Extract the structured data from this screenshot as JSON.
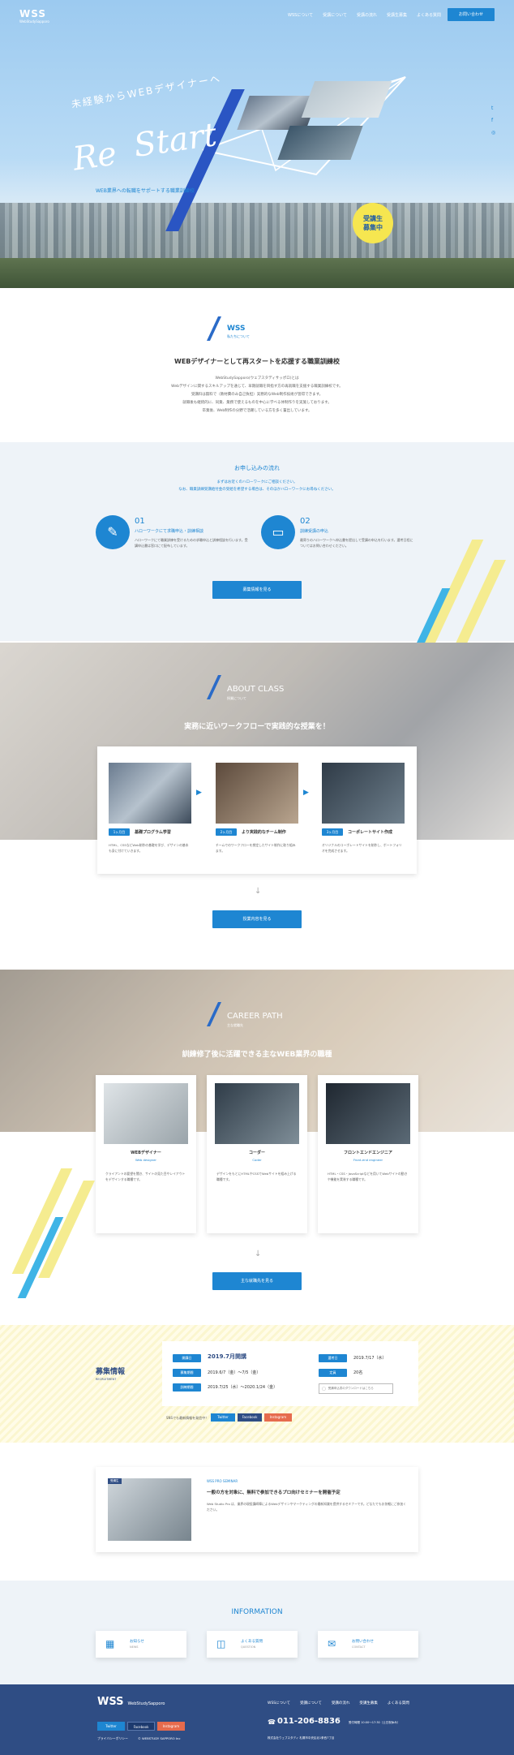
{
  "header": {
    "logo": "WSS",
    "logo_sub": "WebStudySapporo",
    "nav": [
      "WSSについて",
      "受講について",
      "受講の流れ",
      "受講生募集",
      "よくある質問"
    ],
    "cta": "お問い合わせ"
  },
  "hero": {
    "catch": "未経験からWEBデザイナーへ",
    "title_re": "Re",
    "title_start": "Start",
    "sub": "WEB業界への転職をサポートする職業訓練校",
    "badge": "受講生\n募集中",
    "social": [
      "twitter-icon",
      "facebook-icon",
      "instagram-icon"
    ]
  },
  "about": {
    "name": "WSS",
    "kana": "私たちについて",
    "heading": "WEBデザイナーとして再スタートを応援する職業訓練校",
    "body": [
      "WebStudySapporo(ウェブスタディサッポロ)とは",
      "Webデザインに関するスキルアップを通じて、早期就職を目指す方の再就職を支援する職業訓練校です。",
      "受講料は無料で（教材費のみ自己負担）実務的なWeb制作技術が習得できます。",
      "就職後も継続的に、同業、業務で使えるものを中心に学べる体制作りを実施しております。",
      "卒業後、Web制作の分野で活躍している方を多く輩出しています。"
    ]
  },
  "flow": {
    "title": "お申し込みの流れ",
    "desc": [
      "まずはお近くのハローワークにご相談ください。",
      "なお、職業訓練受講給付金の受給を希望する場合は、そのほかハローワークにお尋ねください。"
    ],
    "steps": [
      {
        "num": "01",
        "title": "ハローワークにて求職申込・訓練相談",
        "text": "ハローワークにて職業訓練を受けるための求職申込と訓練相談を行います。受講申込書は窓口にて配布しています。"
      },
      {
        "num": "02",
        "title": "訓練受講の申込",
        "text": "最寄りのハローワークへ申込書を提出して受講の申込を行います。選考日程についてはお問い合わせください。"
      }
    ],
    "button": "募集情報を見る"
  },
  "about_class": {
    "title": "ABOUT CLASS",
    "kana": "授業について",
    "heading": "実務に近いワークフローで実践的な授業を！",
    "steps": [
      {
        "tag": "1ヶ月目",
        "title": "基礎プログラム学習",
        "text": "HTML、CSSなどWeb制作の基礎を学び、デザインの基本も身に付けていきます。"
      },
      {
        "tag": "2ヶ月目",
        "title": "より実践的なチーム制作",
        "text": "チームでのワークフローを想定したサイト制作に取り組みます。"
      },
      {
        "tag": "3ヶ月目",
        "title": "コーポレートサイト作成",
        "text": "オリジナルのコーポレートサイトを制作し、ポートフォリオを完成させます。"
      }
    ],
    "button": "授業内容を見る"
  },
  "career": {
    "title": "CAREER PATH",
    "kana": "主な就職先",
    "heading": "訓練修了後に活躍できる主なWEB業界の職種",
    "jobs": [
      {
        "title": "WEBデザイナー",
        "en": "Web designer",
        "text": "クライアントの要望を聞き、サイトの見た目やレイアウトをデザインする職種です。"
      },
      {
        "title": "コーダー",
        "en": "Coder",
        "text": "デザインをもとにHTMLやCSSでWebサイトを組み上げる職種です。"
      },
      {
        "title": "フロントエンドエンジニア",
        "en": "Front-end engineer",
        "text": "HTML・CSS・JavaScriptなどを用いてWebサイトの動きや機能を実装する職種です。"
      }
    ],
    "button": "主な就職先を見る"
  },
  "recruit": {
    "title": "募集情報",
    "en": "RECRUITMENT",
    "rows": [
      {
        "label": "開講日",
        "value": "2019.7月開講"
      },
      {
        "label": "募集期間",
        "value": "2019.6/7（金）〜7/5（金）"
      },
      {
        "label": "訓練期間",
        "value": "2019.7/25（水）〜2020.1/24（金）"
      }
    ],
    "right": [
      {
        "label": "選考日",
        "value": "2019.7/17（水）"
      },
      {
        "label": "定員",
        "value": "20名"
      }
    ],
    "pdf": "受講申込書のダウンロードはこちら",
    "share": "SNSでも最新情報を発信中！",
    "sns": [
      "Twitter",
      "Facebook",
      "Instagram"
    ]
  },
  "seminar": {
    "tag": "WSS PRO SEMINAR",
    "img_label": "受講生",
    "title": "一般の方を対象に、無料で参加できるプロ向けセミナーを開催予定",
    "text": "Web Studio Pro は、業界の現役講師陣によるWebデザインやマーケティングの最新知識を提供するセミナーです。どなたでもお気軽にご参加ください。"
  },
  "info": {
    "title": "INFORMATION",
    "items": [
      {
        "title": "お知らせ",
        "en": "NEWS"
      },
      {
        "title": "よくある質問",
        "en": "QUESTION"
      },
      {
        "title": "お問い合わせ",
        "en": "CONTACT"
      }
    ]
  },
  "footer": {
    "logo": "WSS",
    "logo_sub": "WebStudySapporo",
    "nav": [
      "WSSについて",
      "受講について",
      "受講の流れ",
      "受講生募集",
      "よくある質問"
    ],
    "sns": [
      "Twitter",
      "Facebook",
      "Instagram"
    ],
    "phone": "011-206-8836",
    "hours": "受付時間 10:00〜17:30（土日祝休み）",
    "address": "株式会社ウェブスタディ 札幌市中央区北1条西7丁目",
    "privacy": "プライバシーポリシー",
    "copyright": "© WEBSTUDY SAPPORO Inc"
  },
  "colors": {
    "blue": "#1e86d2",
    "navy": "#2f4d84",
    "yellow": "#f5ec90"
  }
}
